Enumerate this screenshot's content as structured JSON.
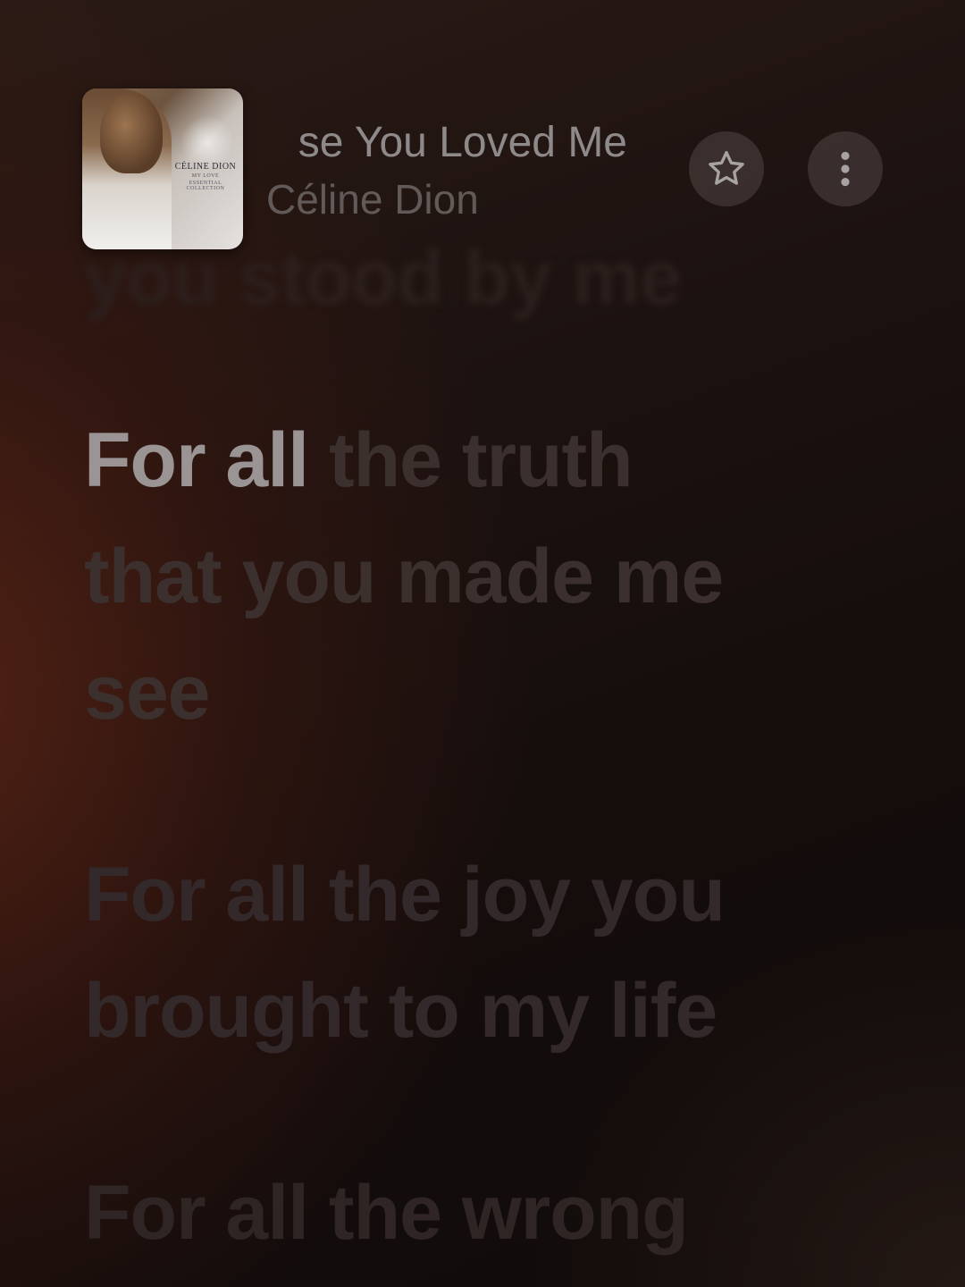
{
  "now_playing": {
    "title": "Because You Loved Me",
    "title_visible": "se You Loved Me",
    "artist": "Céline Dion",
    "artwork": {
      "artist_text": "CÉLINE DION",
      "album_text": "MY LOVE",
      "sub_text": "ESSENTIAL COLLECTION"
    }
  },
  "lyrics": {
    "previous": "you stood by me",
    "current_sung": "For all",
    "current_unsung": " the truth",
    "next_lines": [
      "that you made me",
      "see",
      "For all the joy you",
      "brought to my life",
      "For all the wrong"
    ]
  },
  "icons": {
    "favorite": "star-outline-icon",
    "more": "vertical-ellipsis-icon"
  },
  "colors": {
    "sung_text": "#9a9594",
    "unsung_text": "#3b302d",
    "background_warm": "#5c2414"
  }
}
